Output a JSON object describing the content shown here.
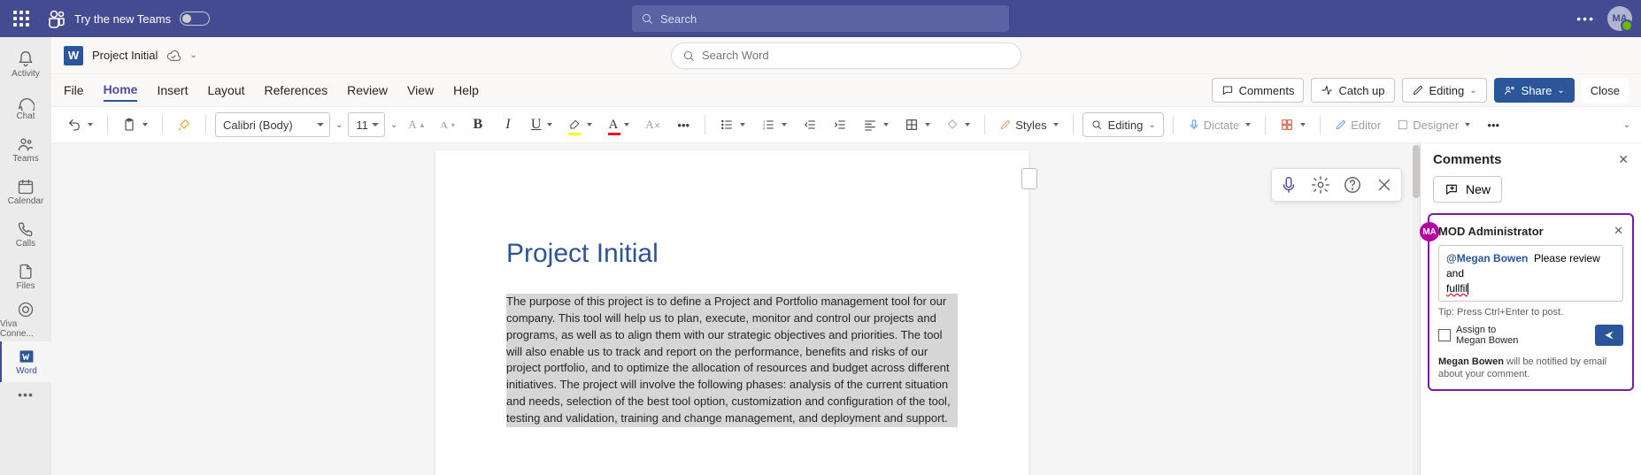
{
  "teams_bar": {
    "try_label": "Try the new Teams",
    "search_placeholder": "Search",
    "avatar_initials": "MA"
  },
  "rail": {
    "items": [
      {
        "label": "Activity"
      },
      {
        "label": "Chat"
      },
      {
        "label": "Teams"
      },
      {
        "label": "Calendar"
      },
      {
        "label": "Calls"
      },
      {
        "label": "Files"
      },
      {
        "label": "Viva Conne..."
      },
      {
        "label": "Word"
      }
    ]
  },
  "title_row": {
    "badge": "W",
    "doc_title": "Project Initial",
    "search_placeholder": "Search Word"
  },
  "ribbon": {
    "tabs": [
      "File",
      "Home",
      "Insert",
      "Layout",
      "References",
      "Review",
      "View",
      "Help"
    ],
    "active_tab": "Home",
    "comments": "Comments",
    "catch_up": "Catch up",
    "editing": "Editing",
    "share": "Share",
    "close": "Close"
  },
  "toolbar": {
    "font_name": "Calibri (Body)",
    "font_size": "11",
    "styles": "Styles",
    "editing": "Editing",
    "dictate": "Dictate",
    "editor": "Editor",
    "designer": "Designer"
  },
  "document": {
    "heading": "Project Initial",
    "body": "The purpose of this project is to define a Project and Portfolio management tool for our company. This tool will help us to plan, execute, monitor and control our projects and programs, as well as to align them with our strategic objectives and priorities. The tool will also enable us to track and report on the performance, benefits and risks of our project portfolio, and to optimize the allocation of resources and budget across different initiatives. The project will involve the following phases: analysis of the current situation and needs, selection of the best tool option, customization and configuration of the tool, testing and validation, training and change management, and deployment and support."
  },
  "comments": {
    "panel_title": "Comments",
    "new_label": "New",
    "card": {
      "avatar": "MA",
      "user": "MOD Administrator",
      "mention": "@Megan Bowen",
      "text_after": "Please review and",
      "text_line2": "fullfil",
      "tip": "Tip: Press Ctrl+Enter to post.",
      "assign_label_1": "Assign to",
      "assign_label_2": "Megan Bowen",
      "notify_name": "Megan Bowen",
      "notify_rest": " will be notified by email about your comment."
    }
  }
}
